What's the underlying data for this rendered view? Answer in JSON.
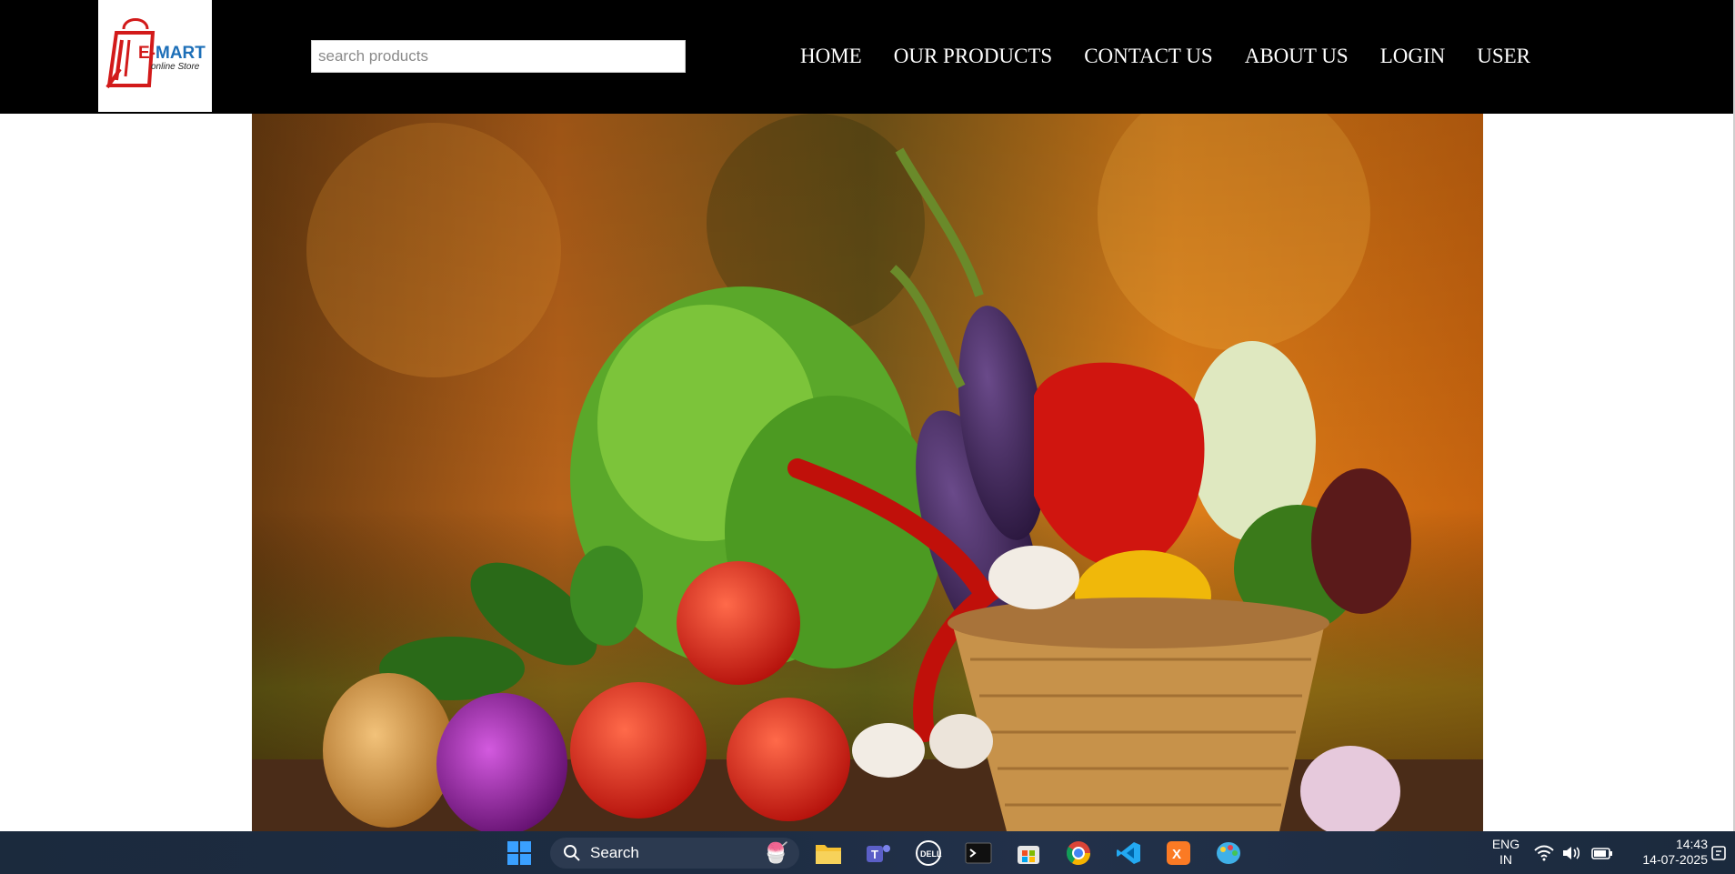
{
  "logo": {
    "brand_prefix": "E-",
    "brand_main": "MART",
    "tagline": "online Store"
  },
  "search": {
    "placeholder": "search products",
    "value": ""
  },
  "nav": {
    "items": [
      {
        "label": "HOME"
      },
      {
        "label": "OUR PRODUCTS"
      },
      {
        "label": "CONTACT US"
      },
      {
        "label": "ABOUT US"
      },
      {
        "label": "LOGIN"
      },
      {
        "label": "USER"
      }
    ]
  },
  "hero": {
    "icon": "vegetable-basket-image"
  },
  "taskbar": {
    "search_label": "Search",
    "language": "ENG",
    "region": "IN",
    "time": "14:43",
    "date": "14-07-2025",
    "icons": [
      "windows-start-icon",
      "search-icon",
      "file-explorer-icon",
      "teams-icon",
      "dell-icon",
      "terminal-icon",
      "store-icon",
      "chrome-icon",
      "vscode-icon",
      "xampp-icon",
      "paint-icon",
      "wifi-icon",
      "volume-icon",
      "battery-icon",
      "notification-icon"
    ]
  },
  "colors": {
    "header_bg": "#000000",
    "nav_text": "#ffffff",
    "logo_blue": "#1d6fb8",
    "logo_red": "#d21a1a",
    "taskbar_bg": "#1b2a3d"
  }
}
